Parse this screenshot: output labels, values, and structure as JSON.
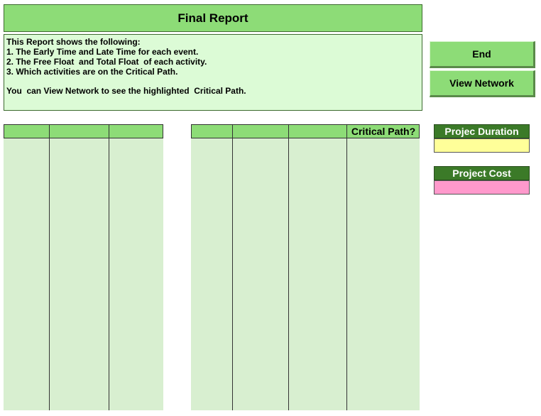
{
  "report": {
    "title": "Final Report",
    "info_lines": [
      "This Report shows the following:",
      "1. The Early Time and Late Time for each event.",
      "2. The Free Float  and Total Float  of each activity.",
      "3. Which activities are on the Critical Path.",
      "You  can View Network to see the highlighted  Critical Path."
    ]
  },
  "buttons": {
    "end": "End",
    "view_network": "View Network"
  },
  "activities_table": {
    "headers": [
      "",
      "",
      "",
      "Critical Path?"
    ]
  },
  "summary": {
    "duration_label": "Projec Duration",
    "duration_value": "",
    "cost_label": "Project Cost",
    "cost_value": ""
  },
  "colors": {
    "header_green": "#8ddc77",
    "info_green": "#dcfbd6",
    "table_body": "#d8efd0",
    "summary_head": "#3b7a28",
    "duration_fill": "#ffff99",
    "cost_fill": "#ff99cc"
  }
}
